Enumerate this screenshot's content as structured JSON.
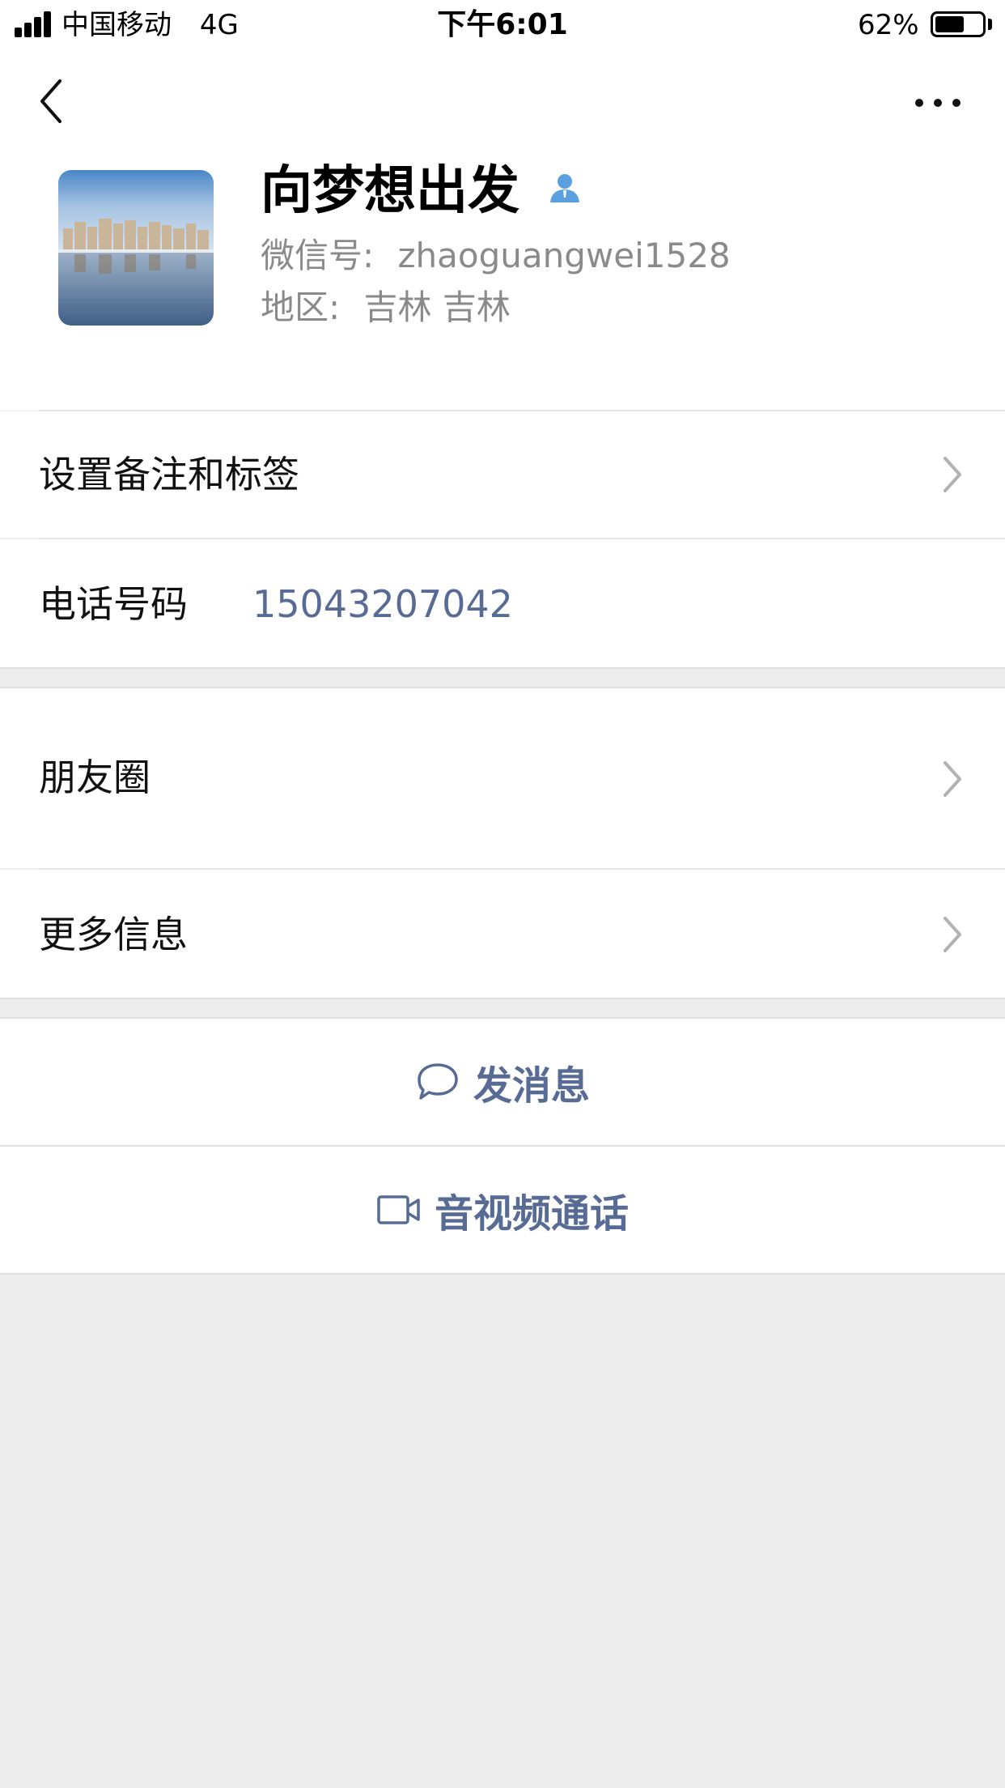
{
  "status_bar": {
    "carrier": "中国移动",
    "network": "4G",
    "time": "下午6:01",
    "battery_percent": "62%",
    "battery_level": 0.62
  },
  "nav": {
    "back_icon": "chevron-left-icon",
    "more_icon": "more-dots-icon"
  },
  "profile": {
    "name": "向梦想出发",
    "badge_icon": "person-icon",
    "badge_color": "#5aa0e0",
    "wechat_id_label": "微信号:",
    "wechat_id": "zhaoguangwei1528",
    "region_label": "地区:",
    "region": "吉林 吉林"
  },
  "rows": {
    "remark_label": "设置备注和标签",
    "phone_label": "电话号码",
    "phone_value": "15043207042",
    "moments_label": "朋友圈",
    "more_info_label": "更多信息"
  },
  "actions": {
    "message_label": "发消息",
    "message_icon": "chat-bubble-icon",
    "call_label": "音视频通话",
    "call_icon": "video-camera-icon"
  },
  "colors": {
    "link": "#576b95",
    "secondary_text": "#8a8a8a",
    "background": "#ededed"
  }
}
